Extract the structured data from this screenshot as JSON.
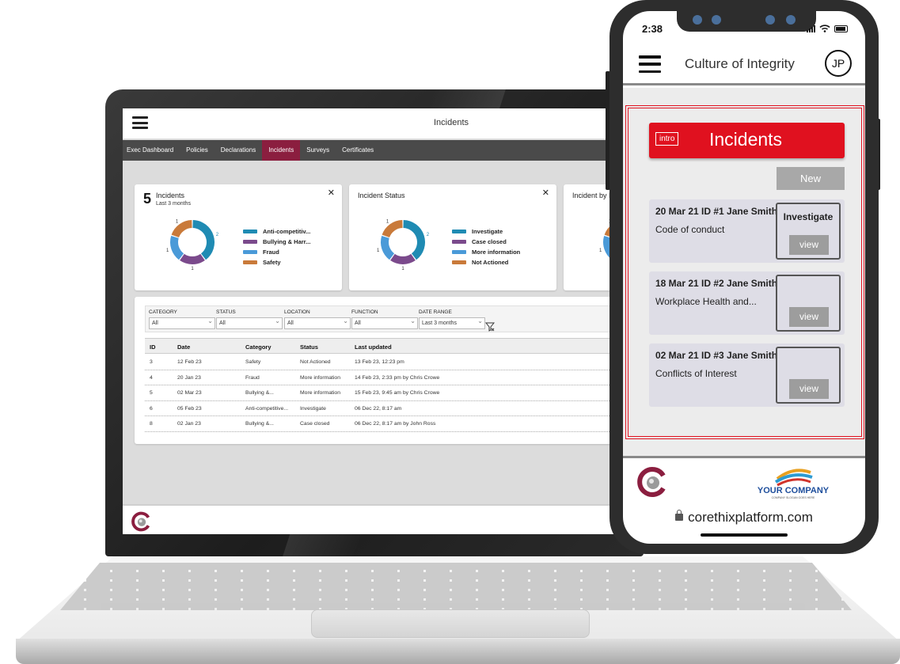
{
  "laptop": {
    "title": "Incidents",
    "nav": [
      "Exec Dashboard",
      "Policies",
      "Declarations",
      "Incidents",
      "Surveys",
      "Certificates"
    ],
    "cards": [
      {
        "count": "5",
        "title": "Incidents",
        "subtitle": "Last 3 months",
        "legend": [
          "Anti-competitiv...",
          "Bullying & Harr...",
          "Fraud",
          "Safety"
        ],
        "values": [
          2,
          1,
          1,
          1
        ],
        "labels": [
          "2",
          "1",
          "1",
          "1"
        ]
      },
      {
        "title": "Incident Status",
        "legend": [
          "Investigate",
          "Case closed",
          "More information",
          "Not Actioned"
        ],
        "values": [
          2,
          1,
          1,
          1
        ],
        "labels": [
          "2",
          "1",
          "1",
          "1"
        ]
      },
      {
        "title": "Incident by I"
      }
    ],
    "colors": [
      "#1f8bb3",
      "#7b4a8c",
      "#4a9ad8",
      "#c97a3a"
    ],
    "filters": [
      {
        "label": "CATEGORY",
        "value": "All"
      },
      {
        "label": "STATUS",
        "value": "All"
      },
      {
        "label": "LOCATION",
        "value": "All"
      },
      {
        "label": "FUNCTION",
        "value": "All"
      },
      {
        "label": "DATE RANGE",
        "value": "Last 3 months"
      }
    ],
    "columns": [
      "ID",
      "Date",
      "Category",
      "Status",
      "Last updated"
    ],
    "rows": [
      [
        "3",
        "12 Feb 23",
        "Safety",
        "Not Actioned",
        "13 Feb 23, 12:23 pm"
      ],
      [
        "4",
        "20 Jan 23",
        "Fraud",
        "More information",
        "14 Feb 23, 2:33 pm by Chris Crowe"
      ],
      [
        "5",
        "02 Mar 23",
        "Bullying &...",
        "More information",
        "15 Feb 23, 9:45 am by Chris Crowe"
      ],
      [
        "6",
        "05 Feb 23",
        "Anti-competitive...",
        "Investigate",
        "06 Dec 22, 8:17 am"
      ],
      [
        "8",
        "02 Jan 23",
        "Bullying &...",
        "Case closed",
        "06 Dec 22, 8:17 am by John Ross"
      ]
    ]
  },
  "phone": {
    "time": "2:38",
    "app_title": "Culture of Integrity",
    "avatar": "JP",
    "intro": "intro",
    "banner_title": "Incidents",
    "new_label": "New",
    "items": [
      {
        "title": "20 Mar 21 ID #1 Jane Smith",
        "desc": "Code of conduct",
        "status": "Investigate",
        "view": "view"
      },
      {
        "title": "18 Mar 21 ID #2 Jane Smith",
        "desc": "Workplace Health and...",
        "status": "",
        "view": "view"
      },
      {
        "title": "02 Mar 21 ID #3 Jane Smith",
        "desc": "Conflicts of Interest",
        "status": "",
        "view": "view"
      }
    ],
    "company_name": "YOUR COMPANY",
    "company_tagline": "COMPANY SLOGAN GOES HERE",
    "url": "corethixplatform.com",
    "accent": "#e0111f"
  }
}
